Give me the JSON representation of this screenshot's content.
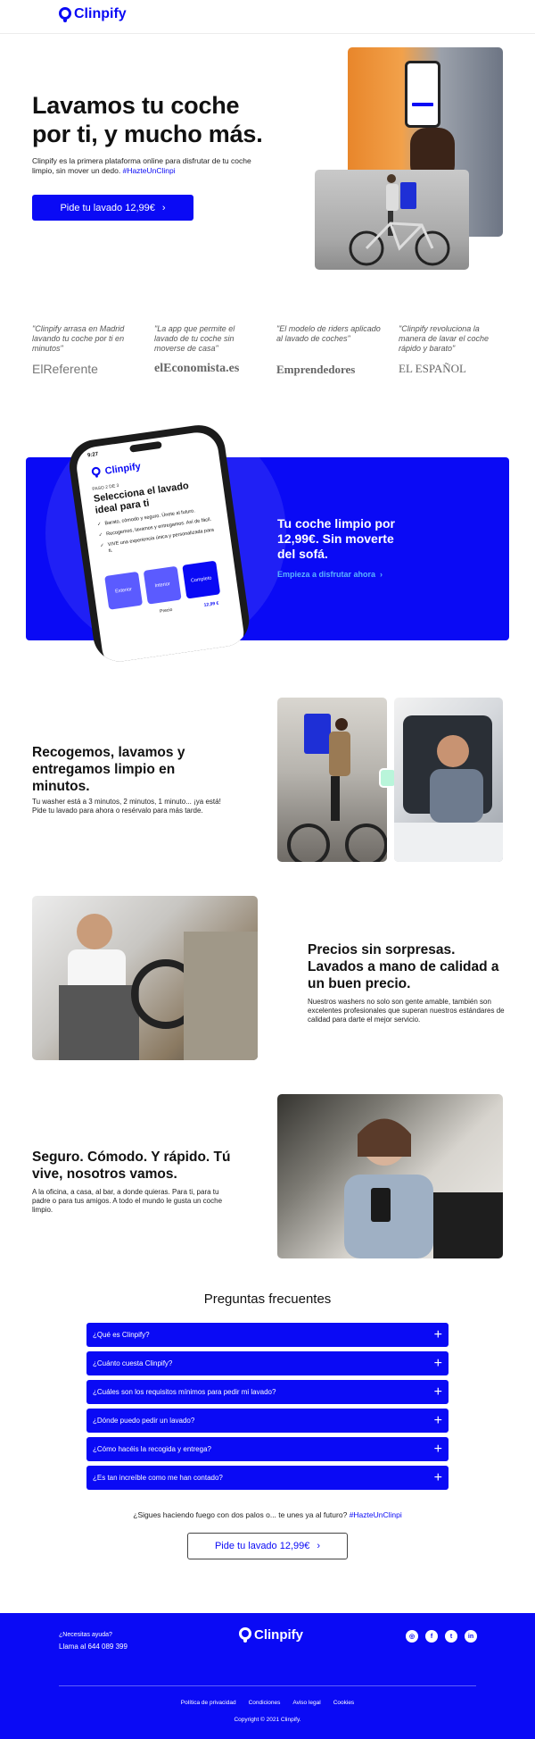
{
  "nav": {
    "logo": "Clinpify"
  },
  "hero": {
    "title_line1": "Lavamos tu coche",
    "title_line2": "por ti, y mucho más.",
    "subtitle": "Clinpify es la primera plataforma online para disfrutar de tu coche limpio, sin mover un dedo.",
    "hashtag": "#HazteUnClinpi",
    "cta": "Pide tu lavado 12,99€",
    "cta_icon": "chevron-right-icon"
  },
  "press": [
    {
      "quote": "\"Clinpify arrasa en Madrid lavando tu coche por ti en minutos\"",
      "outlet": "ElReferente"
    },
    {
      "quote": "\"La app que permite el lavado de tu coche sin moverse de casa\"",
      "outlet": "elEconomista.es"
    },
    {
      "quote": "\"El modelo de riders aplicado al lavado de coches\"",
      "outlet": "Emprendedores"
    },
    {
      "quote": "\"Clinpify revoluciona la manera de lavar el coche rápido y barato\"",
      "outlet": "EL ESPAÑOL"
    }
  ],
  "promo": {
    "phone": {
      "time": "9:27",
      "logo": "Clinpify",
      "step": "PASO 2 DE 3",
      "title": "Selecciona el lavado ideal para ti",
      "checks": [
        "Barato, cómodo y seguro. Únete al futuro.",
        "Recogemos, lavamos y entregamos. Así de fácil.",
        "VIVE una experiencia única y personalizada para ti."
      ],
      "options": [
        "Exterior",
        "Interior",
        "Completo"
      ],
      "price_label": "Precio",
      "price": "12,99 €"
    },
    "title": "Tu coche limpio por 12,99€. Sin moverte del sofá.",
    "link": "Empieza a disfrutar ahora"
  },
  "feature1": {
    "title": "Recogemos, lavamos y entregamos limpio en minutos.",
    "text": "Tu washer está a 3 minutos, 2 minutos, 1 minuto... ¡ya está! Pide tu lavado para ahora o resérvalo para más tarde."
  },
  "feature2": {
    "title": "Precios sin sorpresas. Lavados a mano de calidad a un buen precio.",
    "text": "Nuestros washers no solo son gente amable, también son excelentes profesionales que superan nuestros estándares de calidad para darte el mejor servicio."
  },
  "feature3": {
    "title": "Seguro. Cómodo. Y rápido. Tú vive, nosotros vamos.",
    "text": "A la oficina, a casa, al bar, a donde quieras. Para ti, para tu padre o para tus amigos. A todo el mundo le gusta un coche limpio."
  },
  "faq": {
    "title": "Preguntas frecuentes",
    "items": [
      "¿Qué es Clinpify?",
      "¿Cuánto cuesta Clinpify?",
      "¿Cuáles son los requisitos mínimos para pedir mi lavado?",
      "¿Dónde puedo pedir un lavado?",
      "¿Cómo hacéis la recogida y entrega?",
      "¿Es tan increíble como me han contado?"
    ]
  },
  "closing": {
    "text": "¿Sigues haciendo fuego con dos palos o... te unes ya al futuro?",
    "hashtag": "#HazteUnClinpi",
    "cta": "Pide tu lavado 12,99€"
  },
  "footer": {
    "help": "¿Necesitas ayuda?",
    "phone": "Llama al 644 089 399",
    "logo": "Clinpify",
    "social": [
      "instagram-icon",
      "facebook-icon",
      "twitter-icon",
      "linkedin-icon"
    ],
    "links": [
      "Política de privacidad",
      "Condiciones",
      "Aviso legal",
      "Cookies"
    ],
    "copyright": "Copyright © 2021 Clinpify."
  },
  "colors": {
    "brand_blue": "#0a0af5",
    "light_blue": "#5ab4ff",
    "white": "#ffffff"
  }
}
